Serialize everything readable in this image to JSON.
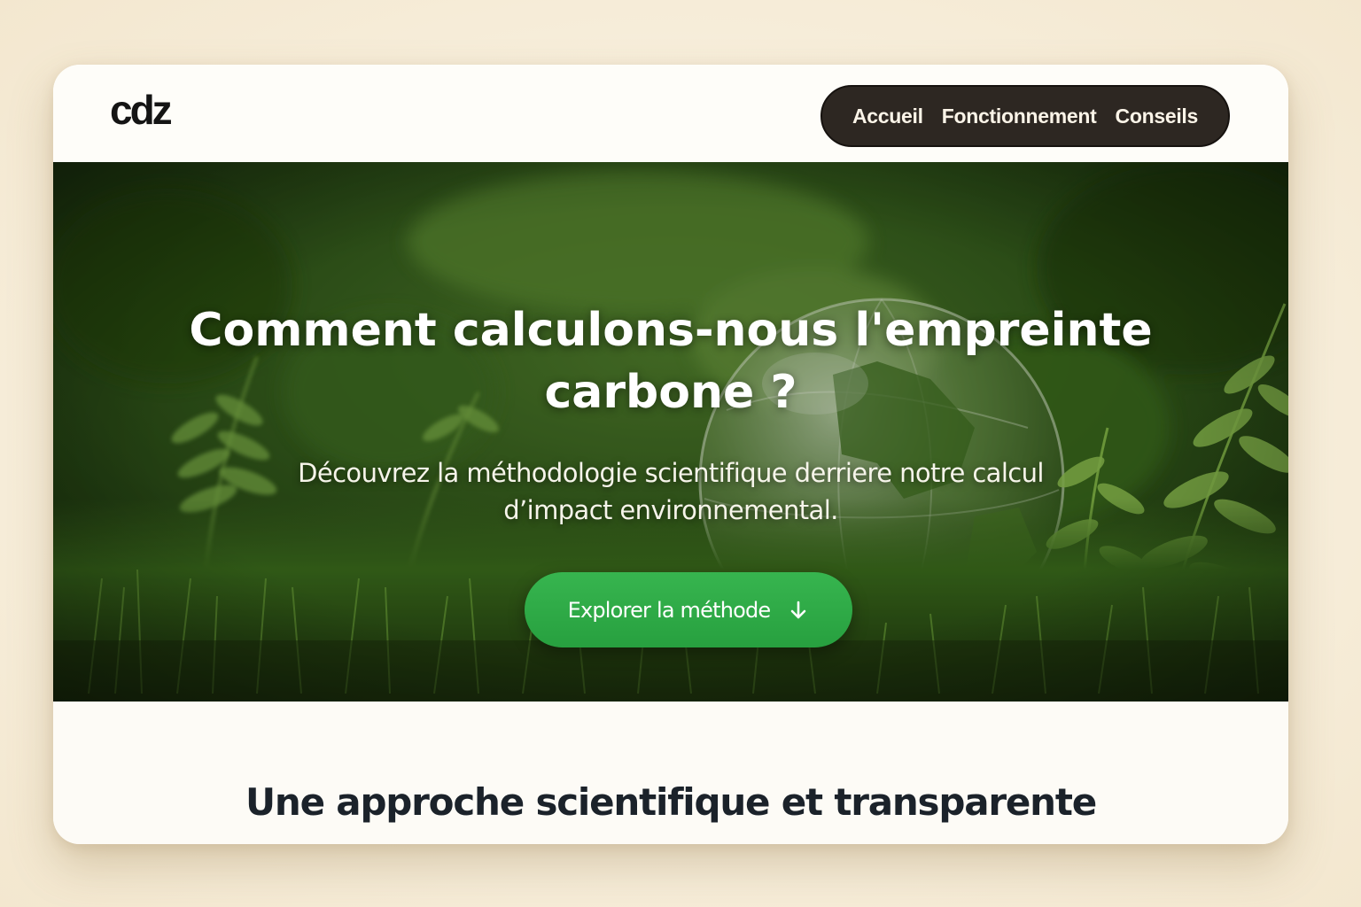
{
  "brand": {
    "logo_text": "cdz",
    "logo_icon": "cdz-logo"
  },
  "nav": {
    "items": [
      {
        "label": "Accueil"
      },
      {
        "label": "Fonctionnement"
      },
      {
        "label": "Conseils"
      }
    ]
  },
  "hero": {
    "title": "Comment calculons-nous l'empreinte carbone ?",
    "subtitle": "Découvrez la méthodologie scientifique derriere notre calcul d’impact environnemental.",
    "cta_label": "Explorer la méthode",
    "cta_icon": "arrow-down-icon",
    "background_image": "fern-and-glass-globe-in-grass"
  },
  "section": {
    "heading": "Une approche scientifique et transparente"
  },
  "colors": {
    "page_background": "#f8f1e1",
    "card_background": "#fdfbf6",
    "nav_background": "#2d2722",
    "nav_text": "#fbf4e8",
    "cta_green": "#2eaa46",
    "heading_text": "#1b222a",
    "hero_text": "#ffffff"
  }
}
